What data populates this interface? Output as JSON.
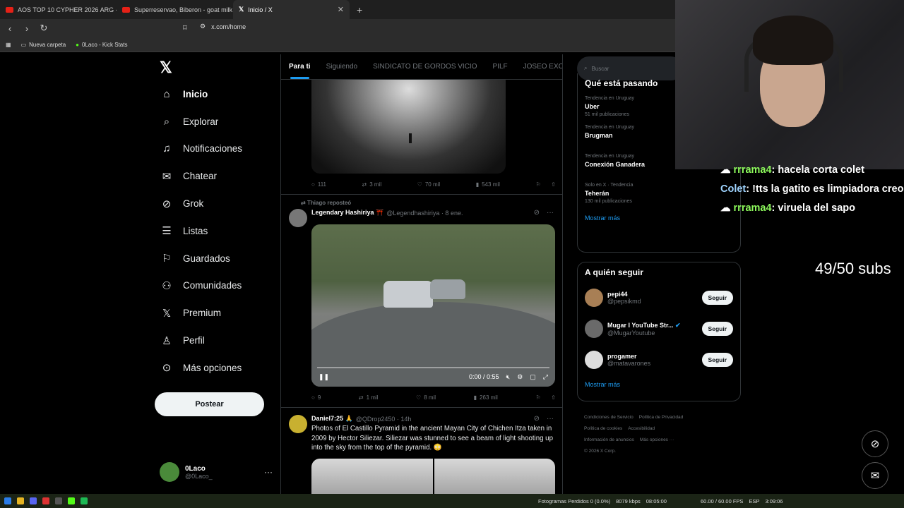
{
  "browser": {
    "tabs": [
      {
        "title": "AOS TOP 10 CYPHER 2026 ARG - You"
      },
      {
        "title": "Superreservao, Biberon - goat milk"
      },
      {
        "title": "Inicio / X",
        "active": true
      }
    ],
    "url": "x.com/home",
    "bookmarks": [
      "Nueva carpeta",
      "0Laco - Kick Stats"
    ]
  },
  "nav": {
    "items": [
      "Inicio",
      "Explorar",
      "Notificaciones",
      "Chatear",
      "Grok",
      "Listas",
      "Guardados",
      "Comunidades",
      "Premium",
      "Perfil",
      "Más opciones"
    ],
    "post_label": "Postear"
  },
  "profile": {
    "name": "0Laco",
    "handle": "@0Laco_"
  },
  "feed": {
    "tabs": [
      "Para ti",
      "Siguiendo",
      "SINDICATO DE GORDOS VICIO",
      "PILF",
      "JOSEO EXCLUSI"
    ],
    "tweet1_stats": {
      "replies": "111",
      "reposts": "3 mil",
      "likes": "70 mil",
      "views": "543 mil"
    },
    "tweet2": {
      "repost_by": "Thiago reposteó",
      "name": "Legendary Hashiriya ⛩️",
      "handle": "@Legendhashiriya · 8 ene.",
      "time": "0:00 / 0:55",
      "stats": {
        "replies": "9",
        "reposts": "1 mil",
        "likes": "8 mil",
        "views": "263 mil"
      }
    },
    "tweet3": {
      "name": "Daniel7:25 🙏",
      "handle": "@QDrop2450 · 14h",
      "text": "Photos of El Castillo Pyramid in the ancient Mayan City of Chichen Itza taken in 2009 by Hector Siliezar. Siliezar was stunned to see a beam of light shooting up into the sky from the top of the pyramid. 😳"
    }
  },
  "sidebar": {
    "search_placeholder": "Buscar",
    "trends_title": "Qué está pasando",
    "trends": [
      {
        "context": "Tendencia en Uruguay",
        "topic": "Uber",
        "posts": "51 mil publicaciones"
      },
      {
        "context": "Tendencia en Uruguay",
        "topic": "Brugman",
        "posts": ""
      },
      {
        "context": "Tendencia en Uruguay",
        "topic": "Conexión Ganadera",
        "posts": ""
      },
      {
        "context": "Solo en X · Tendencia",
        "topic": "Teherán",
        "posts": "130 mil publicaciones"
      }
    ],
    "show_more": "Mostrar más",
    "who_title": "A quién seguir",
    "who": [
      {
        "name": "pepi44",
        "handle": "@pepsikmd"
      },
      {
        "name": "Mugar I YouTube Str...",
        "handle": "@MugarYoutube"
      },
      {
        "name": "progamer",
        "handle": "@matavarones"
      }
    ],
    "follow_label": "Seguir",
    "footer": [
      "Condiciones de Servicio",
      "Política de Privacidad",
      "Política de cookies",
      "Accesibilidad",
      "Información de anuncios",
      "Más opciones ···",
      "© 2026 X Corp."
    ]
  },
  "stream": {
    "chat": [
      {
        "user": "rrrama4",
        "msg": ": hacela corta colet"
      },
      {
        "user": "Colet",
        "msg": ": !tts la gatito es limpiadora creo"
      },
      {
        "user": "rrrama4",
        "msg": ": viruela del sapo"
      }
    ],
    "subs": "49/50 subs"
  },
  "taskbar": {
    "dropped": "Fotogramas Perdidos 0 (0.0%)",
    "bitrate": "8079 kbps",
    "rec": "08:05:00",
    "fps": "60.00 / 60.00 FPS",
    "lang": "ESP",
    "clock": "3:09:06"
  }
}
